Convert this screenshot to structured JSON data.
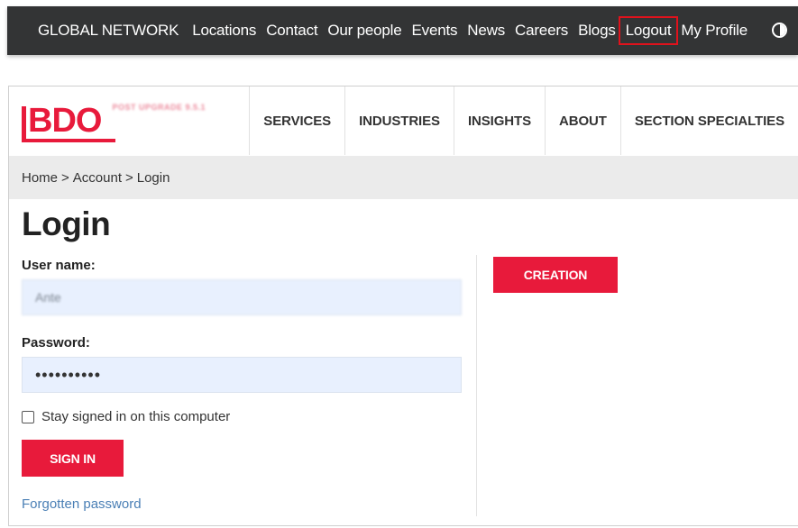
{
  "topbar": {
    "links": [
      "GLOBAL NETWORK",
      "Locations",
      "Contact",
      "Our people",
      "Events",
      "News",
      "Careers",
      "Blogs",
      "Logout",
      "My Profile"
    ]
  },
  "header": {
    "logo_text": "BDO",
    "tagline": "POST UPGRADE 9.5.1",
    "nav": [
      "SERVICES",
      "INDUSTRIES",
      "INSIGHTS",
      "ABOUT",
      "SECTION SPECIALTIES"
    ]
  },
  "breadcrumb": {
    "home": "Home",
    "account": "Account",
    "current": "Login",
    "separator": ">"
  },
  "page": {
    "title": "Login"
  },
  "form": {
    "username_label": "User name:",
    "username_value": "Ante",
    "password_label": "Password:",
    "password_value": "••••••••••",
    "remember_label": "Stay signed in on this computer",
    "signin_label": "SIGN IN",
    "forgot_label": "Forgotten password"
  },
  "sidebar": {
    "creation_label": "CREATION"
  },
  "colors": {
    "brand_red": "#e81a3b",
    "topbar_bg": "#333435",
    "input_bg": "#e8f0fe",
    "link_blue": "#4a7fb5"
  }
}
